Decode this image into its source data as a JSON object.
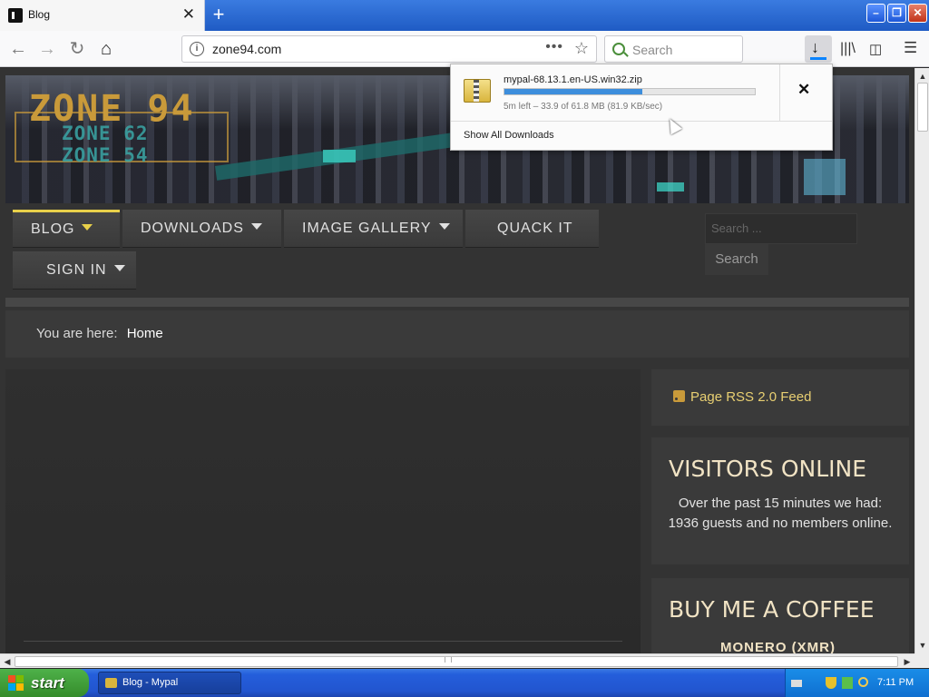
{
  "browser": {
    "tab_title": "Blog",
    "tab_close": "✕",
    "new_tab": "+",
    "url": "zone94.com",
    "url_menu": "•••",
    "search_placeholder": "Search",
    "accent": "#0a84ff"
  },
  "downloads": {
    "filename": "mypal-68.13.1.en-US.win32.zip",
    "status": "5m left – 33.9 of 61.8 MB (81.9 KB/sec)",
    "progress_fraction": 0.549,
    "cancel_label": "✕",
    "show_all": "Show All Downloads"
  },
  "site": {
    "logo_main": "ZONE 94",
    "logo_sub1": "ZONE 62",
    "logo_sub2": "ZONE 54",
    "menu": [
      {
        "label": "BLOG",
        "has_caret": true,
        "active": true
      },
      {
        "label": "DOWNLOADS",
        "has_caret": true,
        "active": false
      },
      {
        "label": "IMAGE GALLERY",
        "has_caret": true,
        "active": false
      },
      {
        "label": "QUACK IT",
        "has_caret": false,
        "active": false
      },
      {
        "label": "SIGN IN",
        "has_caret": true,
        "active": false
      }
    ],
    "search_placeholder": "Search ...",
    "search_button": "Search",
    "breadcrumb_prefix": "You are here:",
    "breadcrumb_home": "Home",
    "rss_label": "Page RSS 2.0 Feed",
    "visitors_title": "VISITORS ONLINE",
    "visitors_text": "Over the past 15 minutes we had: 1936 guests and no members online.",
    "coffee_title": "BUY ME A COFFEE",
    "coffee_sub": "MONERO (XMR)",
    "accent_yellow": "#e8d04a"
  },
  "taskbar": {
    "start_label": "start",
    "window_item": "Blog - Mypal",
    "clock": "7:11 PM"
  }
}
